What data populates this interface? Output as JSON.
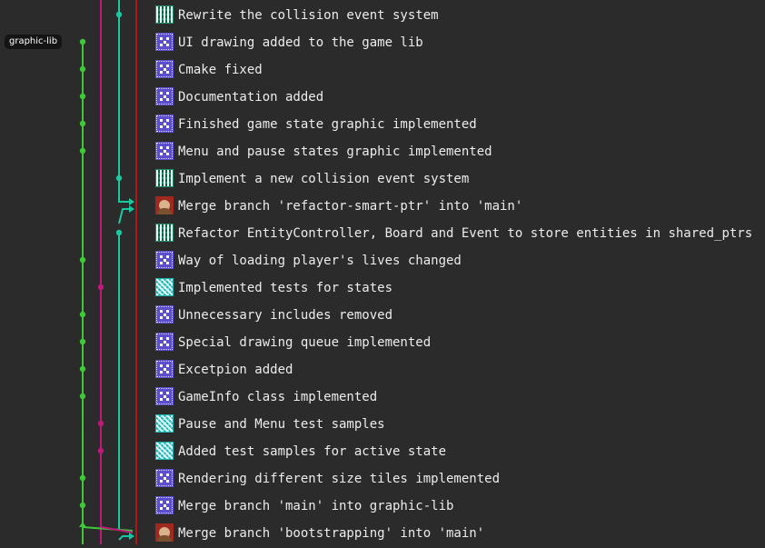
{
  "branch_label": "graphic-lib",
  "colors": {
    "background": "#2b2b2b",
    "lane_cyan": "#1ec7a0",
    "lane_magenta": "#c0187a",
    "lane_green": "#3ec83a",
    "lane_red": "#b01818"
  },
  "commits": [
    {
      "message": "Rewrite the collision event system",
      "avatar": "green-identicon",
      "lane": "cyan"
    },
    {
      "message": "UI drawing added to the game lib",
      "avatar": "blue-identicon",
      "lane": "green"
    },
    {
      "message": "Cmake fixed",
      "avatar": "blue-identicon",
      "lane": "green"
    },
    {
      "message": "Documentation added",
      "avatar": "blue-identicon",
      "lane": "green"
    },
    {
      "message": "Finished game state graphic implemented",
      "avatar": "blue-identicon",
      "lane": "green"
    },
    {
      "message": "Menu and pause states graphic implemented",
      "avatar": "blue-identicon",
      "lane": "green"
    },
    {
      "message": "Implement a new collision event system",
      "avatar": "green-identicon",
      "lane": "cyan"
    },
    {
      "message": "Merge branch 'refactor-smart-ptr' into 'main'",
      "avatar": "photo-avatar",
      "lane": "red"
    },
    {
      "message": "Refactor EntityController, Board and Event to store entities in shared_ptrs",
      "avatar": "green-identicon",
      "lane": "cyan"
    },
    {
      "message": "Way of loading player's lives changed",
      "avatar": "blue-identicon",
      "lane": "green"
    },
    {
      "message": "Implemented tests for states",
      "avatar": "cyan-identicon",
      "lane": "magenta"
    },
    {
      "message": "Unnecessary includes removed",
      "avatar": "blue-identicon",
      "lane": "green"
    },
    {
      "message": "Special drawing queue implemented",
      "avatar": "blue-identicon",
      "lane": "green"
    },
    {
      "message": "Excetpion added",
      "avatar": "blue-identicon",
      "lane": "green"
    },
    {
      "message": "GameInfo class implemented",
      "avatar": "blue-identicon",
      "lane": "green"
    },
    {
      "message": "Pause and Menu test samples",
      "avatar": "cyan-identicon",
      "lane": "magenta"
    },
    {
      "message": "Added test samples for active state",
      "avatar": "cyan-identicon",
      "lane": "magenta"
    },
    {
      "message": "Rendering different size tiles implemented",
      "avatar": "blue-identicon",
      "lane": "green"
    },
    {
      "message": "Merge branch 'main' into graphic-lib",
      "avatar": "blue-identicon",
      "lane": "green"
    },
    {
      "message": "Merge branch 'bootstrapping' into 'main'",
      "avatar": "photo-avatar",
      "lane": "red"
    }
  ]
}
